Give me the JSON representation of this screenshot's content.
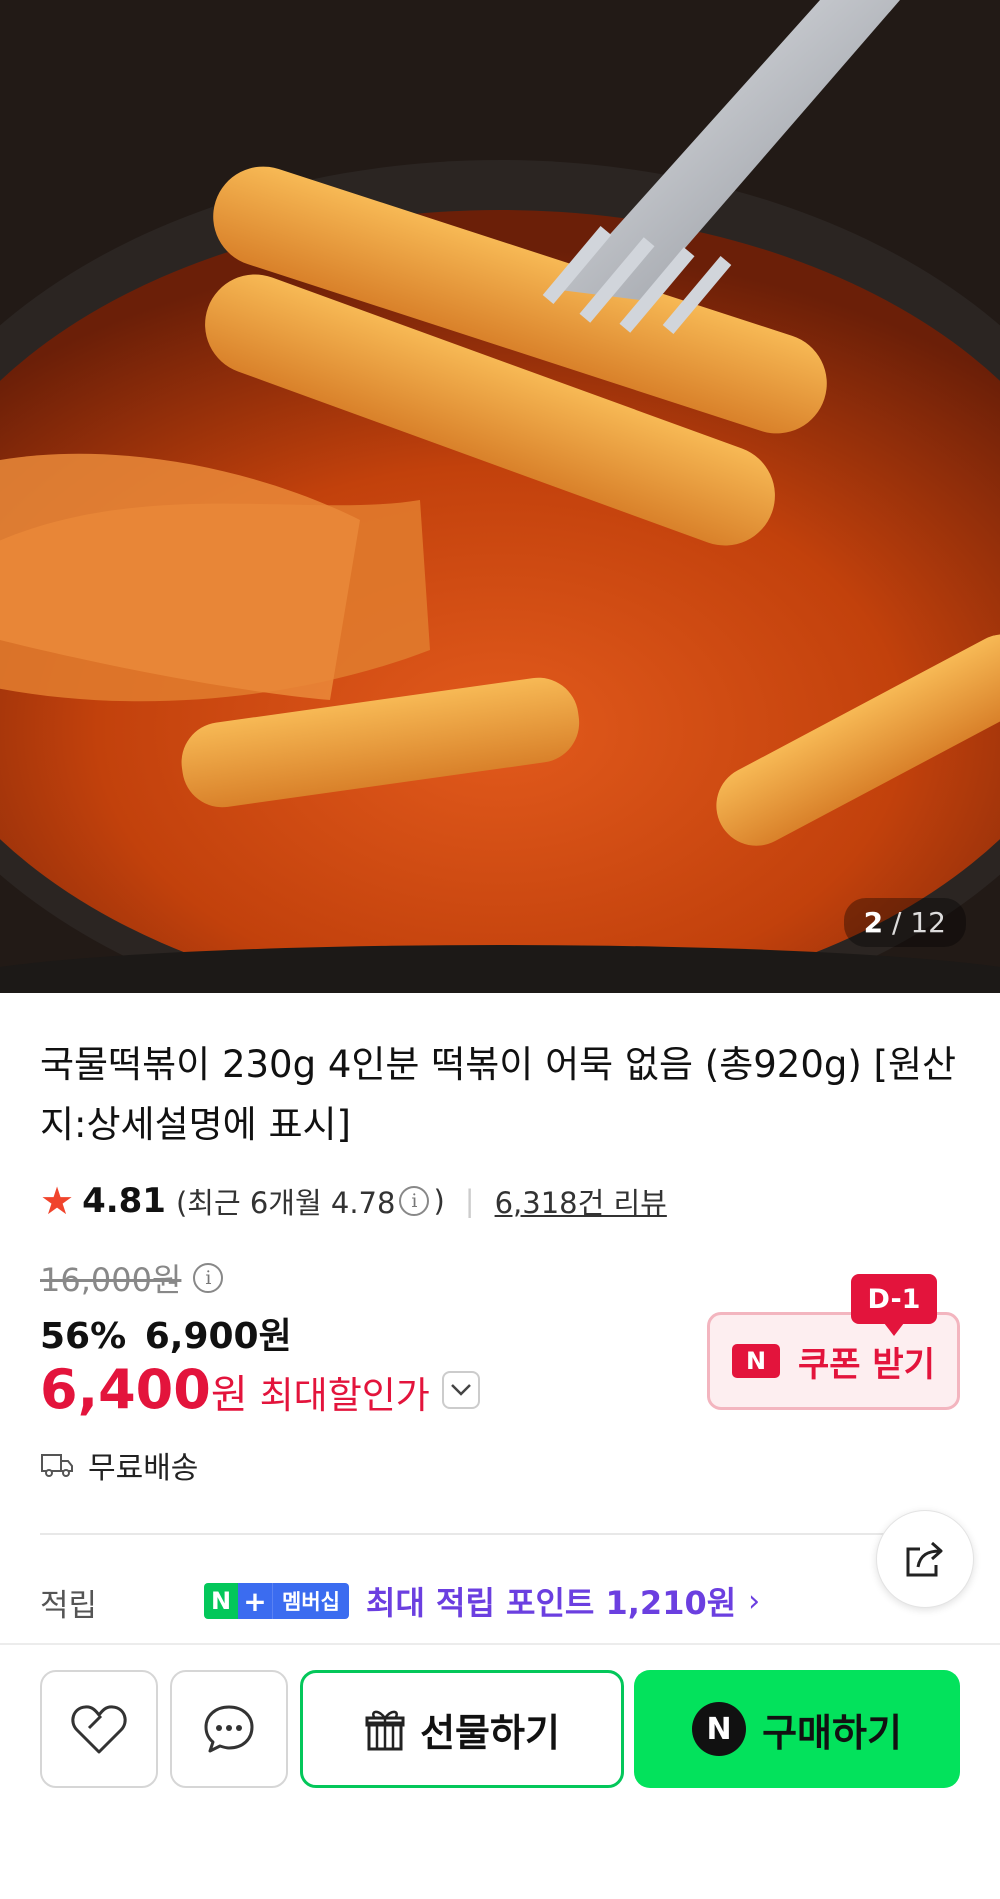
{
  "gallery": {
    "current": "2",
    "separator": "/",
    "total": "12"
  },
  "product": {
    "title": "국물떡볶이 230g 4인분 떡볶이 어묵 없음 (총920g) [원산지:상세설명에 표시]"
  },
  "rating": {
    "score": "4.81",
    "recent_prefix": "(최근 6개월 4.78",
    "recent_suffix": ")",
    "separator": "|",
    "reviews": "6,318건 리뷰"
  },
  "price": {
    "original": "16,000원",
    "discount_percent": "56%",
    "sale_price": "6,900원",
    "max_discount_number": "6,400",
    "max_discount_won": "원",
    "max_discount_label": "최대할인가"
  },
  "coupon": {
    "badge": "D-1",
    "logo": "N",
    "label": "쿠폰 받기"
  },
  "shipping": {
    "label": "무료배송"
  },
  "points": {
    "label": "적립",
    "badge_n": "N",
    "badge_plus": "+",
    "badge_membership": "멤버십",
    "text": "최대 적립 포인트 1,210원",
    "arrow": "›"
  },
  "actions": {
    "gift_label": "선물하기",
    "buy_logo": "N",
    "buy_label": "구매하기"
  },
  "colors": {
    "accent_red": "#e3143c",
    "naver_green": "#03c75a",
    "buy_green": "#03e25c",
    "points_purple": "#6b3fe0"
  },
  "icons": [
    "star-icon",
    "info-icon",
    "chevron-down-icon",
    "truck-icon",
    "share-icon",
    "heart-icon",
    "chat-icon",
    "gift-icon",
    "chevron-right-icon"
  ]
}
